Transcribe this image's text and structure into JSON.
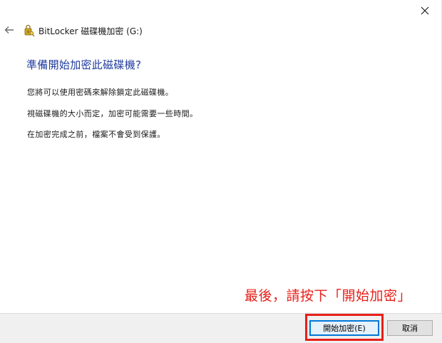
{
  "window": {
    "title": "BitLocker 磁碟機加密 (G:)"
  },
  "main": {
    "heading": "準備開始加密此磁碟機?",
    "paragraphs": [
      "您將可以使用密碼來解除鎖定此磁碟機。",
      "視磁碟機的大小而定，加密可能需要一些時間。",
      "在加密完成之前，檔案不會受到保護。"
    ]
  },
  "annotation": {
    "text": "最後，請按下「開始加密」",
    "color": "#e8201a"
  },
  "footer": {
    "start_button": "開始加密(E)",
    "cancel_button": "取消"
  },
  "colors": {
    "heading": "#1f3b9e",
    "primary_border": "#0078d7",
    "footer_bg": "#f0f0f0"
  },
  "icons": {
    "close": "close-icon",
    "back": "back-arrow-icon",
    "bitlocker": "bitlocker-key-icon"
  }
}
